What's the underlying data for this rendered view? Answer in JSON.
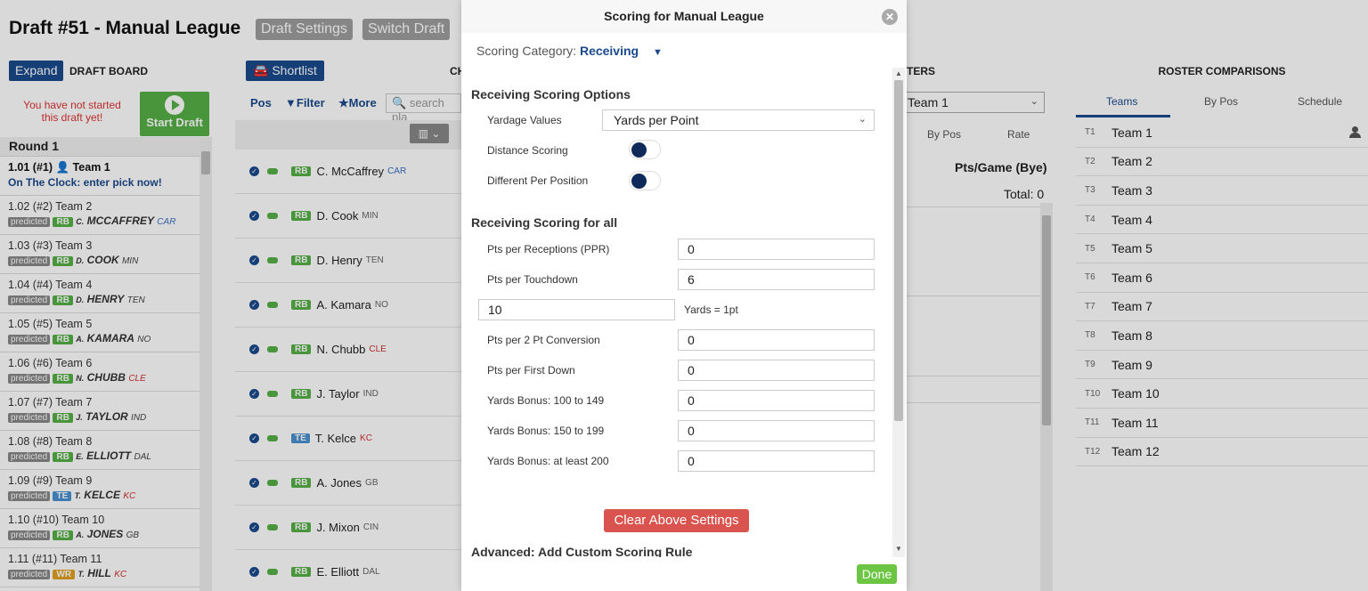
{
  "app": {
    "title": "Draft #51 - Manual League",
    "draft_settings": "Draft Settings",
    "switch_draft": "Switch Draft"
  },
  "board": {
    "expand": "Expand",
    "label": "DRAFT BOARD",
    "not_started": "You have not started this draft yet!",
    "start": "Start Draft",
    "round": "Round 1",
    "first_pick": {
      "num": "1.01 (#1)",
      "team": "Team 1",
      "clock": "On The Clock: enter pick now!"
    },
    "picks": [
      {
        "num": "1.02 (#2) Team 2",
        "pred": "predicted",
        "pos": "RB",
        "init": "C.",
        "name": "MCCAFFREY",
        "team": "CAR"
      },
      {
        "num": "1.03 (#3) Team 3",
        "pred": "predicted",
        "pos": "RB",
        "init": "D.",
        "name": "COOK",
        "team": "MIN"
      },
      {
        "num": "1.04 (#4) Team 4",
        "pred": "predicted",
        "pos": "RB",
        "init": "D.",
        "name": "HENRY",
        "team": "TEN"
      },
      {
        "num": "1.05 (#5) Team 5",
        "pred": "predicted",
        "pos": "RB",
        "init": "A.",
        "name": "KAMARA",
        "team": "NO"
      },
      {
        "num": "1.06 (#6) Team 6",
        "pred": "predicted",
        "pos": "RB",
        "init": "N.",
        "name": "CHUBB",
        "team": "CLE"
      },
      {
        "num": "1.07 (#7) Team 7",
        "pred": "predicted",
        "pos": "RB",
        "init": "J.",
        "name": "TAYLOR",
        "team": "IND"
      },
      {
        "num": "1.08 (#8) Team 8",
        "pred": "predicted",
        "pos": "RB",
        "init": "E.",
        "name": "ELLIOTT",
        "team": "DAL"
      },
      {
        "num": "1.09 (#9) Team 9",
        "pred": "predicted",
        "pos": "TE",
        "init": "T.",
        "name": "KELCE",
        "team": "KC"
      },
      {
        "num": "1.10 (#10) Team 10",
        "pred": "predicted",
        "pos": "RB",
        "init": "A.",
        "name": "JONES",
        "team": "GB"
      },
      {
        "num": "1.11 (#11) Team 11",
        "pred": "predicted",
        "pos": "WR",
        "init": "T.",
        "name": "HILL",
        "team": "KC"
      }
    ]
  },
  "shortlist": {
    "btn": "Shortlist",
    "ch": "CH",
    "pos": "Pos",
    "filter": "Filter",
    "more": "More",
    "search_placeholder": "search pla",
    "players": [
      {
        "pos": "RB",
        "name": "C. McCaffrey",
        "team": "CAR"
      },
      {
        "pos": "RB",
        "name": "D. Cook",
        "team": "MIN"
      },
      {
        "pos": "RB",
        "name": "D. Henry",
        "team": "TEN"
      },
      {
        "pos": "RB",
        "name": "A. Kamara",
        "team": "NO"
      },
      {
        "pos": "RB",
        "name": "N. Chubb",
        "team": "CLE"
      },
      {
        "pos": "RB",
        "name": "J. Taylor",
        "team": "IND"
      },
      {
        "pos": "TE",
        "name": "T. Kelce",
        "team": "KC"
      },
      {
        "pos": "RB",
        "name": "A. Jones",
        "team": "GB"
      },
      {
        "pos": "RB",
        "name": "J. Mixon",
        "team": "CIN"
      },
      {
        "pos": "RB",
        "name": "E. Elliott",
        "team": "DAL"
      }
    ]
  },
  "rosters": {
    "title": "TERS",
    "team_select": "Team 1",
    "by_pos": "By Pos",
    "rate": "Rate",
    "pts_game": "Pts/Game (Bye)",
    "total": "Total: 0"
  },
  "comparisons": {
    "title": "ROSTER COMPARISONS",
    "tabs": [
      "Teams",
      "By Pos",
      "Schedule"
    ],
    "teams": [
      {
        "no": "T1",
        "name": "Team 1"
      },
      {
        "no": "T2",
        "name": "Team 2"
      },
      {
        "no": "T3",
        "name": "Team 3"
      },
      {
        "no": "T4",
        "name": "Team 4"
      },
      {
        "no": "T5",
        "name": "Team 5"
      },
      {
        "no": "T6",
        "name": "Team 6"
      },
      {
        "no": "T7",
        "name": "Team 7"
      },
      {
        "no": "T8",
        "name": "Team 8"
      },
      {
        "no": "T9",
        "name": "Team 9"
      },
      {
        "no": "T10",
        "name": "Team 10"
      },
      {
        "no": "T11",
        "name": "Team 11"
      },
      {
        "no": "T12",
        "name": "Team 12"
      }
    ]
  },
  "modal": {
    "title": "Scoring for Manual League",
    "category_label": "Scoring Category:",
    "category_value": "Receiving",
    "options_header": "Receiving Scoring Options",
    "yardage_label": "Yardage Values",
    "yardage_value": "Yards per Point",
    "distance_label": "Distance Scoring",
    "diff_pos_label": "Different Per Position",
    "scoring_header": "Receiving Scoring for all",
    "ppr_label": "Pts per Receptions (PPR)",
    "ppr_value": "0",
    "td_label": "Pts per Touchdown",
    "td_value": "6",
    "yards_value": "10",
    "yards_label": "Yards = 1pt",
    "two_pt_label": "Pts per 2 Pt Conversion",
    "two_pt_value": "0",
    "first_down_label": "Pts per First Down",
    "first_down_value": "0",
    "bonus1_label": "Yards Bonus: 100 to 149",
    "bonus1_value": "0",
    "bonus2_label": "Yards Bonus: 150 to 199",
    "bonus2_value": "0",
    "bonus3_label": "Yards Bonus: at least 200",
    "bonus3_value": "0",
    "clear": "Clear Above Settings",
    "advanced": "Advanced: Add Custom Scoring Rule",
    "done": "Done"
  }
}
